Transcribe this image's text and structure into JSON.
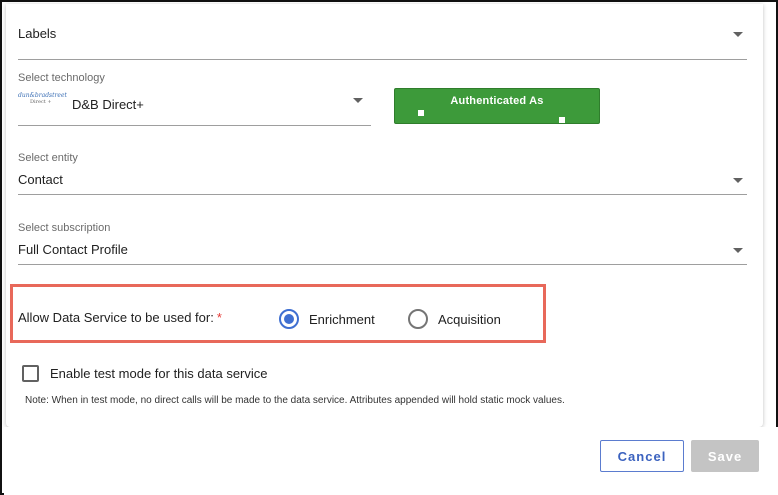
{
  "labels_field": {
    "value": "Labels"
  },
  "technology_field": {
    "label": "Select technology",
    "value": "D&B Direct+",
    "logo_line1": "dun&bradstreet",
    "logo_line2": "Direct +"
  },
  "auth_button": {
    "label": "Authenticated As"
  },
  "entity_field": {
    "label": "Select entity",
    "value": "Contact"
  },
  "subscription_field": {
    "label": "Select subscription",
    "value": "Full Contact Profile"
  },
  "usage": {
    "label": "Allow Data Service to be used for:",
    "required_mark": "*",
    "options": [
      {
        "label": "Enrichment",
        "checked": true
      },
      {
        "label": "Acquisition",
        "checked": false
      }
    ]
  },
  "test_mode": {
    "label": "Enable test mode for this data service",
    "checked": false,
    "note": "Note: When in test mode, no direct calls will be made to the data service. Attributes appended will hold static mock values."
  },
  "footer": {
    "cancel_label": "Cancel",
    "save_label": "Save"
  },
  "colors": {
    "accent": "#3f6fd1",
    "auth_green": "#3d9a3a",
    "highlight": "#e8685a",
    "required": "#e53935",
    "disabled": "#c4c4c4"
  }
}
